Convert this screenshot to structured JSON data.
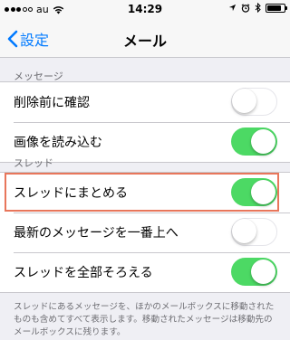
{
  "status_bar": {
    "carrier": "au",
    "time": "14:29",
    "battery_level": 0.85
  },
  "nav": {
    "back_label": "設定",
    "title": "メール"
  },
  "sections": [
    {
      "header": "メッセージ",
      "rows": [
        {
          "label": "削除前に確認",
          "on": false
        },
        {
          "label": "画像を読み込む",
          "on": true
        }
      ]
    },
    {
      "header": "スレッド",
      "rows": [
        {
          "label": "スレッドにまとめる",
          "on": true
        },
        {
          "label": "最新のメッセージを一番上へ",
          "on": false
        },
        {
          "label": "スレッドを全部そろえる",
          "on": true
        }
      ]
    }
  ],
  "footer_text": "スレッドにあるメッセージを、ほかのメールボックスに移動されたものも含めてすべて表示します。移動されたメッセージは移動先のメールボックスに残ります。",
  "colors": {
    "accent": "#007aff",
    "toggle_on": "#4cd964",
    "highlight": "#e8765b"
  }
}
